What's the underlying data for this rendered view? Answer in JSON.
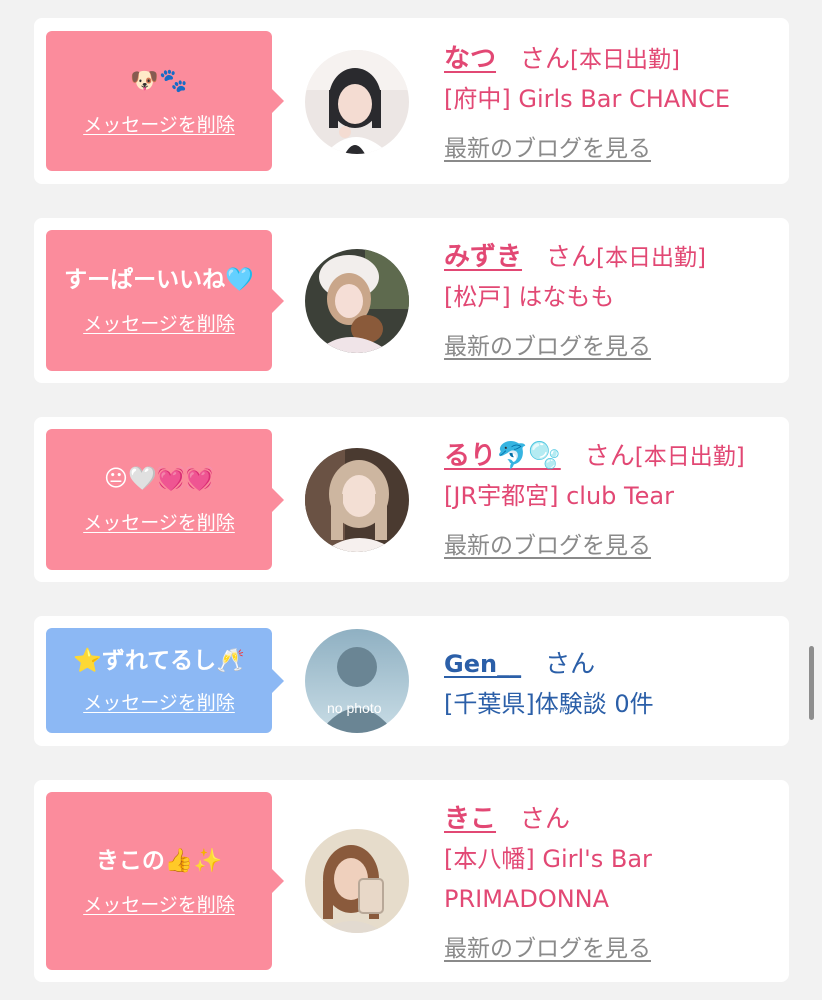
{
  "items": [
    {
      "message": "🐶🐾",
      "delete_label": "メッセージを削除",
      "name": "なつ",
      "honorific": "さん",
      "status": "[本日出勤]",
      "shop": "[府中] Girls Bar CHANCE",
      "blog_label": "最新のブログを見る"
    },
    {
      "message": "すーぱーいいね🩵",
      "delete_label": "メッセージを削除",
      "name": "みずき",
      "honorific": "さん",
      "status": "[本日出勤]",
      "shop": "[松戸] はなもも",
      "blog_label": "最新のブログを見る"
    },
    {
      "message": "😐🤍💓💓",
      "delete_label": "メッセージを削除",
      "name": "るり🐬🫧",
      "honorific": "さん",
      "status": "[本日出勤]",
      "shop": "[JR宇都宮] club Tear",
      "blog_label": "最新のブログを見る"
    },
    {
      "message": "⭐ずれてるし🥂",
      "delete_label": "メッセージを削除",
      "name": "Gen__",
      "honorific": "さん",
      "shop": "[千葉県]体験談 0件",
      "avatar_text": "no photo"
    },
    {
      "message": "きこの👍✨",
      "delete_label": "メッセージを削除",
      "name": "きこ",
      "honorific": "さん",
      "shop": "[本八幡] Girl's Bar\nPRIMADONNA",
      "blog_label": "最新のブログを見る"
    }
  ],
  "colors": {
    "pink_bubble": "#fb8c9c",
    "blue_bubble": "#8cb8f4",
    "cast_text": "#e24874",
    "user_text": "#2b5fa8",
    "link_gray": "#8a8a8a"
  }
}
